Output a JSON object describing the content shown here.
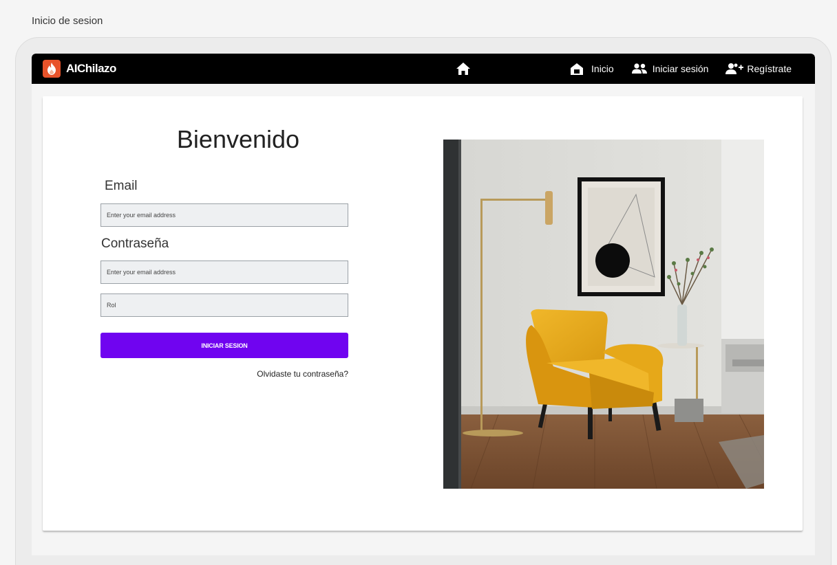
{
  "page": {
    "label": "Inicio de sesion"
  },
  "navbar": {
    "brand": "AIChilazo",
    "links": [
      {
        "label": "Inicio",
        "icon": "house-icon"
      },
      {
        "label": "Iniciar sesión",
        "icon": "people-icon"
      },
      {
        "label": "Regístrate",
        "icon": "person-add-icon"
      }
    ]
  },
  "login": {
    "title": "Bienvenido",
    "email_label": "Email",
    "email_placeholder": "Enter your email address",
    "password_label": "Contraseña",
    "password_placeholder": "Enter your email address",
    "role_placeholder": "Rol",
    "submit_label": "INICIAR SESION",
    "forgot_label": "Olvidaste tu contraseña?"
  },
  "colors": {
    "navbar": "#000000",
    "accent": "#7004f0",
    "logo": "#e8532a",
    "input_bg": "#eef0f2"
  }
}
